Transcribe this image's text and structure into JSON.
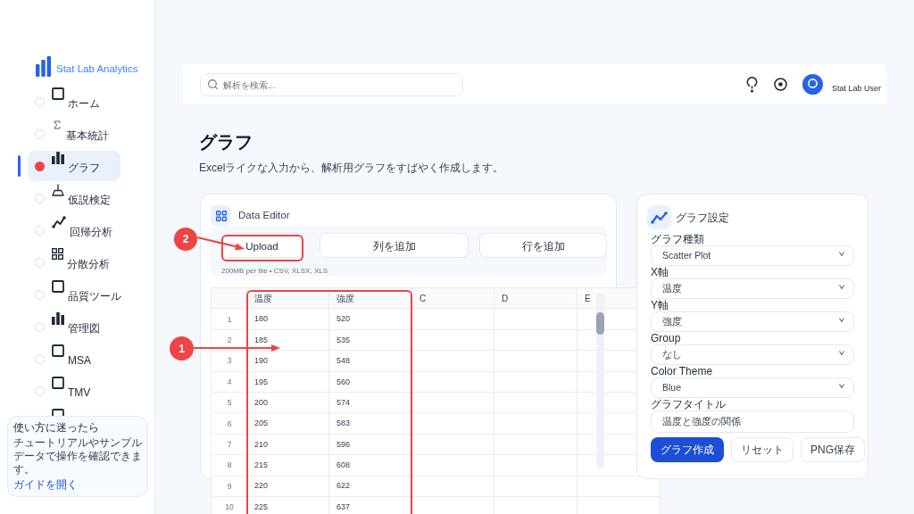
{
  "sidebar": {
    "logo": "Stat Lab Analytics",
    "items": [
      {
        "label": "ホーム",
        "kind": "square",
        "selected": false
      },
      {
        "label": "基本統計",
        "kind": "sigma",
        "selected": false
      },
      {
        "label": "グラフ",
        "kind": "bars",
        "selected": true
      },
      {
        "label": "仮説検定",
        "kind": "beaker",
        "selected": false
      },
      {
        "label": "回帰分析",
        "kind": "trend",
        "selected": false
      },
      {
        "label": "分散分析",
        "kind": "grid",
        "selected": false
      },
      {
        "label": "品質ツール",
        "kind": "square",
        "selected": false
      },
      {
        "label": "管理図",
        "kind": "bars",
        "selected": false
      },
      {
        "label": "MSA",
        "kind": "square",
        "selected": false
      },
      {
        "label": "TMV",
        "kind": "square",
        "selected": false
      },
      {
        "kind": "square",
        "selected": false
      }
    ],
    "help": {
      "title": "使い方に迷ったら",
      "text": "チュートリアルやサンプルデータで操作を確認できます。",
      "link": "ガイドを開く"
    }
  },
  "top_bar": {
    "search": {
      "placeholder": "解析を検索..."
    },
    "user": "Stat Lab User"
  },
  "header": {
    "title": "グラフ",
    "subtitle": "Excelライクな入力から、解析用グラフをすばやく作成します。"
  },
  "data_editor": {
    "title": "Data Editor",
    "buttons": [
      "Upload",
      "列を追加",
      "行を追加"
    ],
    "note": "200MB per file • CSV, XLSX, XLS",
    "table": {
      "columns": [
        "温度",
        "強度",
        "C",
        "D",
        "E"
      ],
      "rows": [
        {
          "number": "1",
          "cells": [
            "180",
            "520"
          ]
        },
        {
          "number": "2",
          "cells": [
            "185",
            "535"
          ]
        },
        {
          "number": "3",
          "cells": [
            "190",
            "548"
          ]
        },
        {
          "number": "4",
          "cells": [
            "195",
            "560"
          ]
        },
        {
          "number": "5",
          "cells": [
            "200",
            "574"
          ]
        },
        {
          "number": "6",
          "cells": [
            "205",
            "583"
          ]
        },
        {
          "number": "7",
          "cells": [
            "210",
            "596"
          ]
        },
        {
          "number": "8",
          "cells": [
            "215",
            "608"
          ]
        },
        {
          "number": "9",
          "cells": [
            "220",
            "622"
          ]
        },
        {
          "number": "10",
          "cells": [
            "225",
            "637"
          ]
        }
      ]
    }
  },
  "graph_settings": {
    "title": "グラフ設定",
    "fields": [
      {
        "label": "グラフ種類",
        "kind": "select",
        "value": "Scatter Plot"
      },
      {
        "label": "X軸",
        "kind": "select",
        "value": "温度"
      },
      {
        "label": "Y軸",
        "kind": "select",
        "value": "強度"
      },
      {
        "label": "Group",
        "kind": "select",
        "value": "なし"
      },
      {
        "label": "Color Theme",
        "kind": "select",
        "value": "Blue"
      },
      {
        "label": "グラフタイトル",
        "kind": "text",
        "value": "温度と強度の関係"
      }
    ],
    "buttons": [
      {
        "label": "グラフ作成",
        "kind": "primary"
      },
      {
        "label": "リセット",
        "kind": "secondary"
      },
      {
        "label": "PNG保存",
        "kind": "secondary"
      }
    ]
  },
  "callouts": [
    {
      "number": "1",
      "kind": "columns"
    },
    {
      "number": "2",
      "kind": "upload"
    }
  ]
}
